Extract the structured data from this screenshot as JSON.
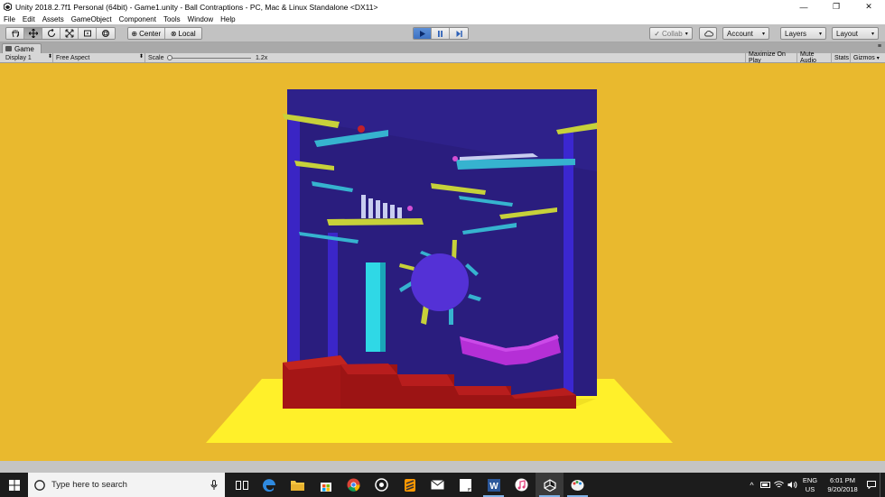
{
  "window": {
    "title": "Unity 2018.2.7f1 Personal (64bit) - Game1.unity - Ball Contraptions - PC, Mac & Linux Standalone <DX11>",
    "minimize": "—",
    "maximize": "❐",
    "close": "✕"
  },
  "menu": [
    "File",
    "Edit",
    "Assets",
    "GameObject",
    "Component",
    "Tools",
    "Window",
    "Help"
  ],
  "toolbar": {
    "tools": [
      "hand-tool-icon",
      "move-tool-icon",
      "rotate-tool-icon",
      "scale-tool-icon",
      "rect-tool-icon",
      "transform-tool-icon"
    ],
    "pivot_label": "Center",
    "space_label": "Local",
    "collab_label": "Collab",
    "account_label": "Account",
    "layers_label": "Layers",
    "layout_label": "Layout"
  },
  "game_tab": {
    "label": "Game"
  },
  "game_bar": {
    "display": "Display 1",
    "aspect": "Free Aspect",
    "scale_label": "Scale",
    "scale_value": "1.2x",
    "maximize_on_play": "Maximize On Play",
    "mute_audio": "Mute Audio",
    "stats": "Stats",
    "gizmos": "Gizmos"
  },
  "colors": {
    "background": "#e9b92e",
    "backboard": "#2a1d7e",
    "floor": "#fff02a",
    "steps": "#a51616",
    "wheel": "#5431d6",
    "ramp": "#b52fd6"
  },
  "taskbar": {
    "search_placeholder": "Type here to search",
    "apps": [
      "task-view-icon",
      "edge-icon",
      "file-explorer-icon",
      "store-icon",
      "chrome-icon",
      "media-icon",
      "sublime-icon",
      "mail-icon",
      "notes-icon",
      "word-icon",
      "itunes-icon",
      "unity-icon",
      "paint-icon"
    ],
    "language": "ENG",
    "region": "US",
    "time": "6:01 PM",
    "date": "9/20/2018"
  }
}
